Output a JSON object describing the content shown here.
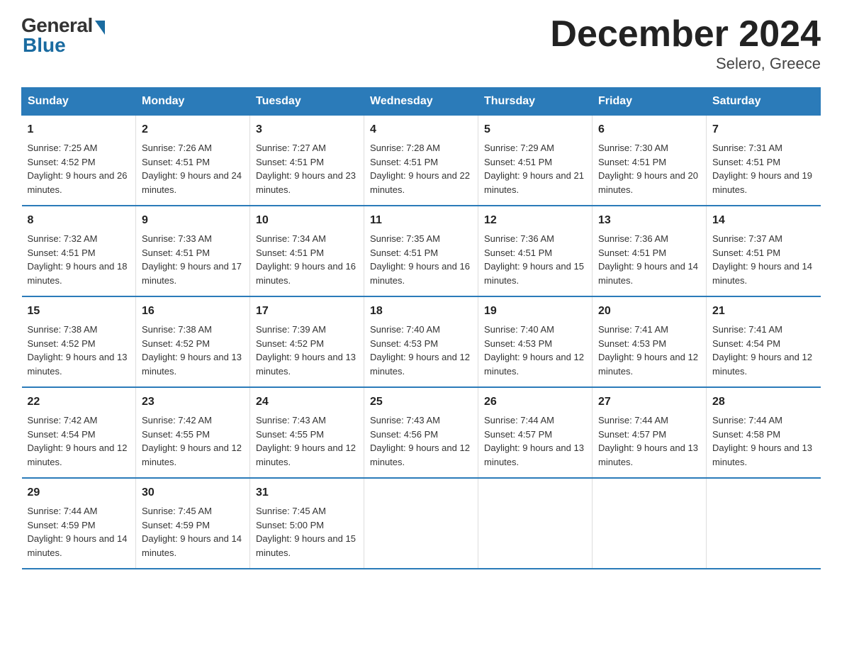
{
  "logo": {
    "general": "General",
    "blue": "Blue",
    "subtitle": "Blue"
  },
  "title": "December 2024",
  "location": "Selero, Greece",
  "days_of_week": [
    "Sunday",
    "Monday",
    "Tuesday",
    "Wednesday",
    "Thursday",
    "Friday",
    "Saturday"
  ],
  "weeks": [
    [
      {
        "day": "1",
        "sunrise": "7:25 AM",
        "sunset": "4:52 PM",
        "daylight": "9 hours and 26 minutes."
      },
      {
        "day": "2",
        "sunrise": "7:26 AM",
        "sunset": "4:51 PM",
        "daylight": "9 hours and 24 minutes."
      },
      {
        "day": "3",
        "sunrise": "7:27 AM",
        "sunset": "4:51 PM",
        "daylight": "9 hours and 23 minutes."
      },
      {
        "day": "4",
        "sunrise": "7:28 AM",
        "sunset": "4:51 PM",
        "daylight": "9 hours and 22 minutes."
      },
      {
        "day": "5",
        "sunrise": "7:29 AM",
        "sunset": "4:51 PM",
        "daylight": "9 hours and 21 minutes."
      },
      {
        "day": "6",
        "sunrise": "7:30 AM",
        "sunset": "4:51 PM",
        "daylight": "9 hours and 20 minutes."
      },
      {
        "day": "7",
        "sunrise": "7:31 AM",
        "sunset": "4:51 PM",
        "daylight": "9 hours and 19 minutes."
      }
    ],
    [
      {
        "day": "8",
        "sunrise": "7:32 AM",
        "sunset": "4:51 PM",
        "daylight": "9 hours and 18 minutes."
      },
      {
        "day": "9",
        "sunrise": "7:33 AM",
        "sunset": "4:51 PM",
        "daylight": "9 hours and 17 minutes."
      },
      {
        "day": "10",
        "sunrise": "7:34 AM",
        "sunset": "4:51 PM",
        "daylight": "9 hours and 16 minutes."
      },
      {
        "day": "11",
        "sunrise": "7:35 AM",
        "sunset": "4:51 PM",
        "daylight": "9 hours and 16 minutes."
      },
      {
        "day": "12",
        "sunrise": "7:36 AM",
        "sunset": "4:51 PM",
        "daylight": "9 hours and 15 minutes."
      },
      {
        "day": "13",
        "sunrise": "7:36 AM",
        "sunset": "4:51 PM",
        "daylight": "9 hours and 14 minutes."
      },
      {
        "day": "14",
        "sunrise": "7:37 AM",
        "sunset": "4:51 PM",
        "daylight": "9 hours and 14 minutes."
      }
    ],
    [
      {
        "day": "15",
        "sunrise": "7:38 AM",
        "sunset": "4:52 PM",
        "daylight": "9 hours and 13 minutes."
      },
      {
        "day": "16",
        "sunrise": "7:38 AM",
        "sunset": "4:52 PM",
        "daylight": "9 hours and 13 minutes."
      },
      {
        "day": "17",
        "sunrise": "7:39 AM",
        "sunset": "4:52 PM",
        "daylight": "9 hours and 13 minutes."
      },
      {
        "day": "18",
        "sunrise": "7:40 AM",
        "sunset": "4:53 PM",
        "daylight": "9 hours and 12 minutes."
      },
      {
        "day": "19",
        "sunrise": "7:40 AM",
        "sunset": "4:53 PM",
        "daylight": "9 hours and 12 minutes."
      },
      {
        "day": "20",
        "sunrise": "7:41 AM",
        "sunset": "4:53 PM",
        "daylight": "9 hours and 12 minutes."
      },
      {
        "day": "21",
        "sunrise": "7:41 AM",
        "sunset": "4:54 PM",
        "daylight": "9 hours and 12 minutes."
      }
    ],
    [
      {
        "day": "22",
        "sunrise": "7:42 AM",
        "sunset": "4:54 PM",
        "daylight": "9 hours and 12 minutes."
      },
      {
        "day": "23",
        "sunrise": "7:42 AM",
        "sunset": "4:55 PM",
        "daylight": "9 hours and 12 minutes."
      },
      {
        "day": "24",
        "sunrise": "7:43 AM",
        "sunset": "4:55 PM",
        "daylight": "9 hours and 12 minutes."
      },
      {
        "day": "25",
        "sunrise": "7:43 AM",
        "sunset": "4:56 PM",
        "daylight": "9 hours and 12 minutes."
      },
      {
        "day": "26",
        "sunrise": "7:44 AM",
        "sunset": "4:57 PM",
        "daylight": "9 hours and 13 minutes."
      },
      {
        "day": "27",
        "sunrise": "7:44 AM",
        "sunset": "4:57 PM",
        "daylight": "9 hours and 13 minutes."
      },
      {
        "day": "28",
        "sunrise": "7:44 AM",
        "sunset": "4:58 PM",
        "daylight": "9 hours and 13 minutes."
      }
    ],
    [
      {
        "day": "29",
        "sunrise": "7:44 AM",
        "sunset": "4:59 PM",
        "daylight": "9 hours and 14 minutes."
      },
      {
        "day": "30",
        "sunrise": "7:45 AM",
        "sunset": "4:59 PM",
        "daylight": "9 hours and 14 minutes."
      },
      {
        "day": "31",
        "sunrise": "7:45 AM",
        "sunset": "5:00 PM",
        "daylight": "9 hours and 15 minutes."
      },
      null,
      null,
      null,
      null
    ]
  ],
  "labels": {
    "sunrise": "Sunrise:",
    "sunset": "Sunset:",
    "daylight": "Daylight:"
  }
}
